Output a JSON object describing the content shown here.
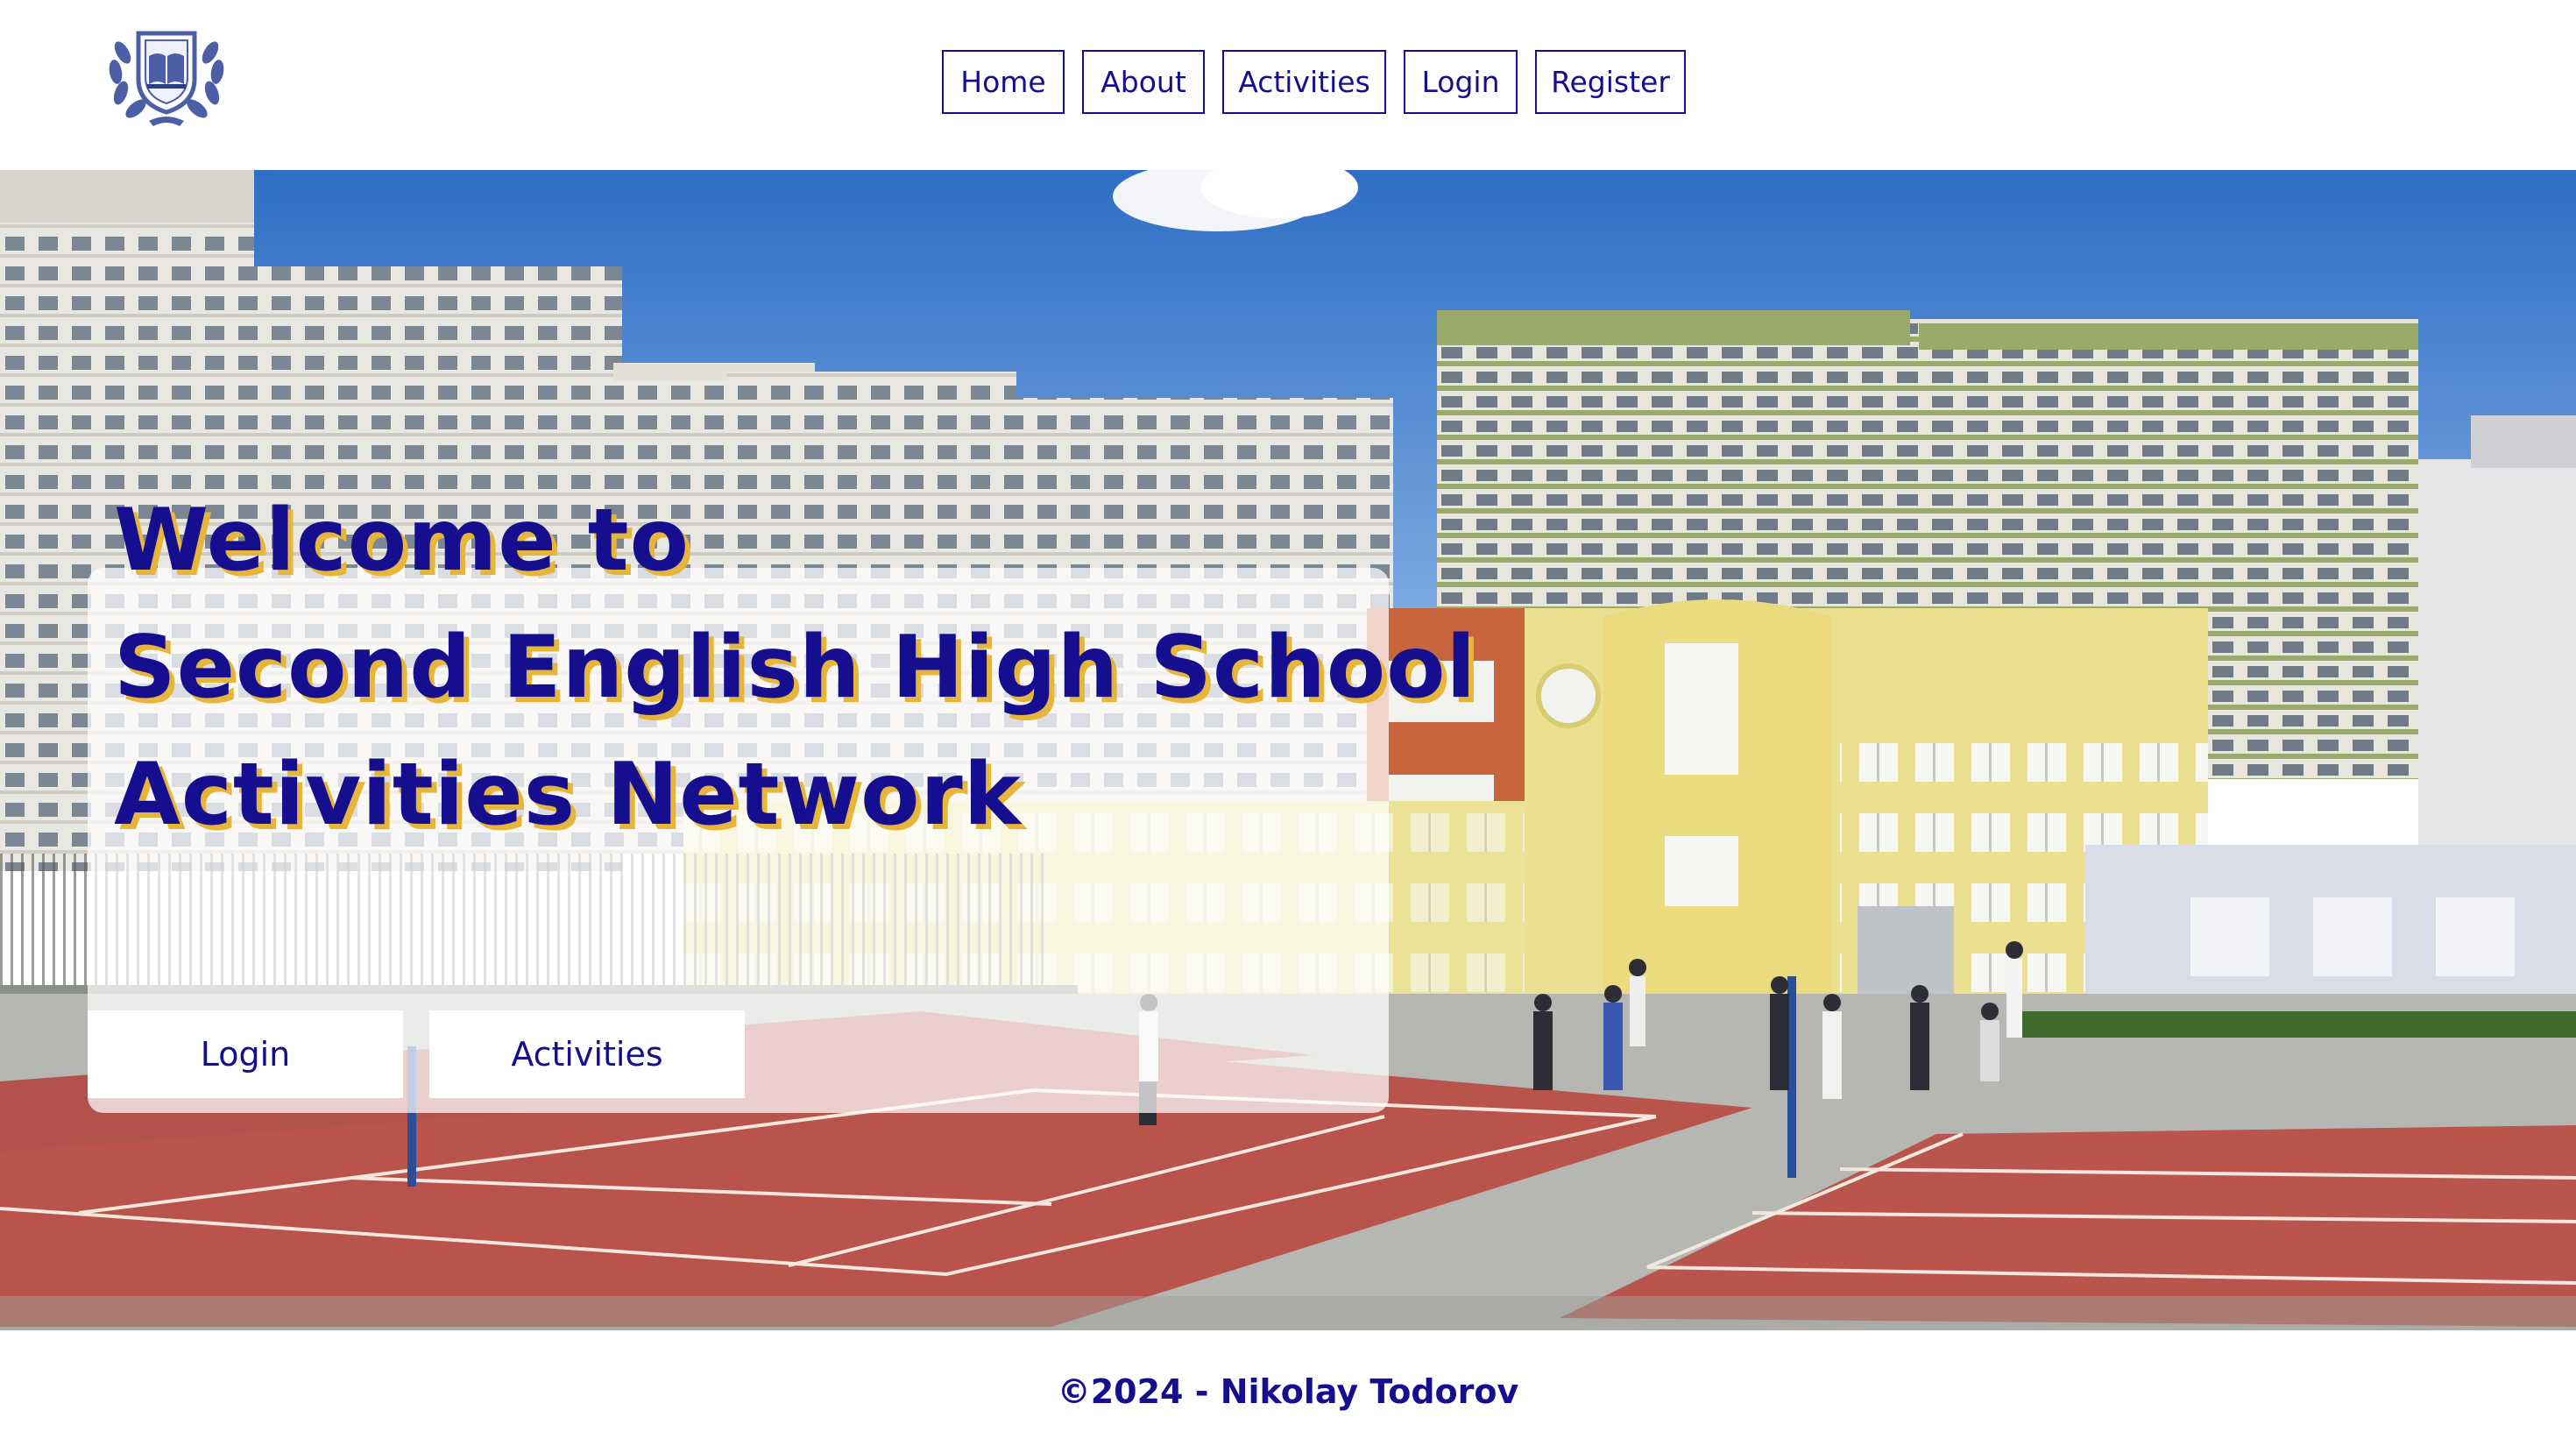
{
  "header": {
    "logo_icon": "school-crest-icon",
    "nav": [
      {
        "label": "Home"
      },
      {
        "label": "About"
      },
      {
        "label": "Activities"
      },
      {
        "label": "Login"
      },
      {
        "label": "Register"
      }
    ]
  },
  "hero": {
    "title_lines": [
      "Welcome to",
      "Second English High School",
      "Activities Network"
    ],
    "buttons": {
      "login": "Login",
      "activities": "Activities"
    },
    "background": "school-building-photo"
  },
  "footer": {
    "text": "©2024 - Nikolay Todorov"
  },
  "colors": {
    "primary": "#150f8f",
    "title_shadow": "#e6b53a",
    "background": "#ffffff"
  }
}
